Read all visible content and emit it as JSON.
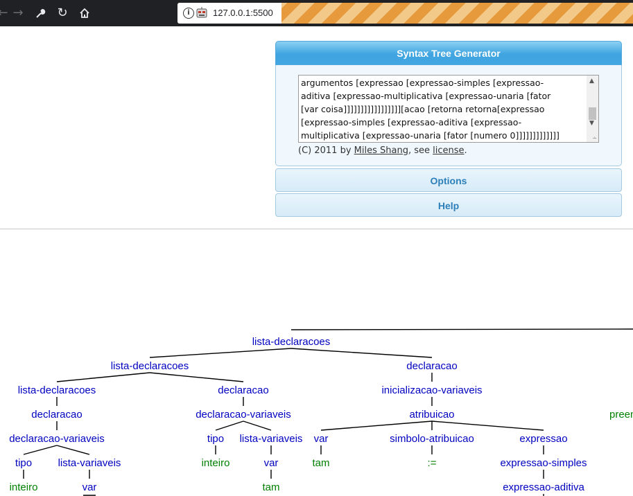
{
  "browser": {
    "url": "127.0.0.1:5500",
    "icons": [
      "back-icon",
      "forward-icon",
      "wrench-icon",
      "reload-icon",
      "home-icon",
      "info-icon",
      "extension-icon"
    ]
  },
  "generator": {
    "title": "Syntax Tree Generator",
    "input_lines": [
      "argumentos [expressao [expressao-simples [expressao-",
      "aditiva [expressao-multiplicativa [expressao-unaria [fator",
      "[var coisa]]]]]]]]]]]]]]]]][acao [retorna retorna[expressao",
      "[expressao-simples [expressao-aditiva [expressao-",
      "multiplicativa [expressao-unaria [fator [numero 0]]]]]]]]]]]]]"
    ],
    "credit_prefix": "(C) 2011 by ",
    "credit_author": "Miles Shang",
    "credit_mid": ", see ",
    "credit_license": "license",
    "credit_suffix": ".",
    "options_label": "Options",
    "help_label": "Help"
  },
  "tree_labels": {
    "n1": "lista-declaracoes",
    "n2": "lista-declaracoes",
    "n3": "declaracao",
    "n4": "lista-declaracoes",
    "n5": "declaracao",
    "n6": "inicializacao-variaveis",
    "n7": "declaracao",
    "n8": "declaracao-variaveis",
    "n9": "atribuicao",
    "n10": "declaracao-variaveis",
    "n11": "tipo",
    "n12": "lista-variaveis",
    "n13": "var",
    "n14": "simbolo-atribuicao",
    "n15": "expressao",
    "n16": "tipo",
    "n17": "lista-variaveis",
    "n18": "inteiro",
    "n19": "var",
    "n20": "tam",
    "n21": ":=",
    "n22": "expressao-simples",
    "n23": "inteiro",
    "n24": "var",
    "n25": "tam",
    "n26": "expressao-aditiva",
    "n27": "preen"
  },
  "colors": {
    "nonterminal": "#0000c0",
    "terminal": "#008000",
    "header": "#3fa4e0"
  }
}
